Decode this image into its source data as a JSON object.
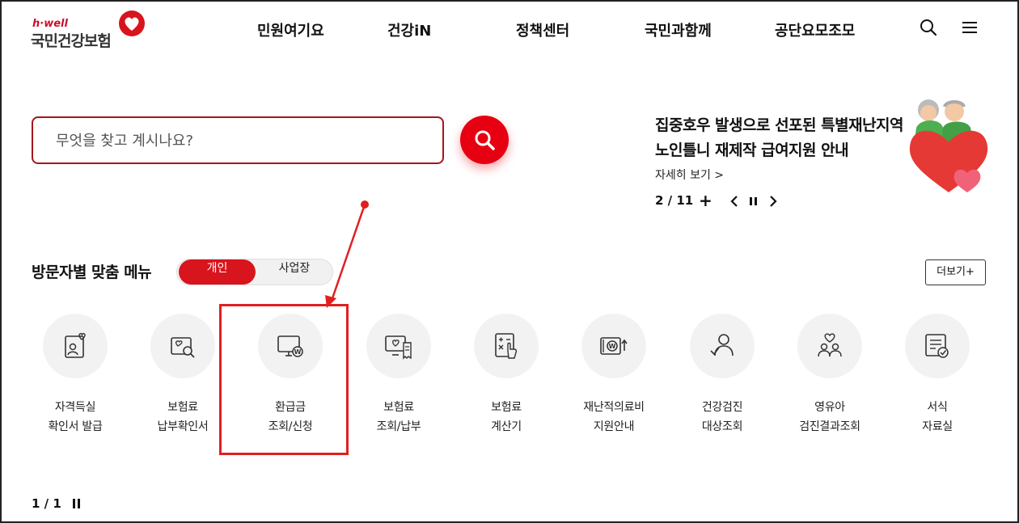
{
  "header": {
    "logo_tagline": "h·well",
    "logo_name": "국민건강보험",
    "nav": [
      "민원여기요",
      "건강iN",
      "정책센터",
      "국민과함께",
      "공단요모조모"
    ],
    "icons": [
      "search-icon",
      "hamburger-menu-icon"
    ]
  },
  "search": {
    "placeholder": "무엇을 찾고 계시나요?",
    "value": ""
  },
  "banner": {
    "title_line1": "집중호우 발생으로 선포된 특별재난지역",
    "title_line2": "노인틀니 재제작 급여지원 안내",
    "link": "자세히 보기 >",
    "page": "2 / 11",
    "plus": "+"
  },
  "section": {
    "title": "방문자별 맞춤 메뉴",
    "toggle": [
      "개인",
      "사업장"
    ],
    "active_toggle": "개인",
    "more": "더보기+"
  },
  "menu": [
    {
      "line1": "자격득실",
      "line2": "확인서 발급",
      "icon": "id-card-heart-icon"
    },
    {
      "line1": "보험료",
      "line2": "납부확인서",
      "icon": "document-search-icon"
    },
    {
      "line1": "환급금",
      "line2": "조회/신청",
      "icon": "monitor-won-icon"
    },
    {
      "line1": "보험료",
      "line2": "조회/납부",
      "icon": "monitor-receipt-icon"
    },
    {
      "line1": "보험료",
      "line2": "계산기",
      "icon": "calculator-icon"
    },
    {
      "line1": "재난적의료비",
      "line2": "지원안내",
      "icon": "won-up-icon"
    },
    {
      "line1": "건강검진",
      "line2": "대상조회",
      "icon": "people-check-icon"
    },
    {
      "line1": "영유아",
      "line2": "검진결과조회",
      "icon": "family-heart-icon"
    },
    {
      "line1": "서식",
      "line2": "자료실",
      "icon": "form-check-icon"
    }
  ],
  "pager": {
    "page": "1 / 1"
  },
  "colors": {
    "brand_red": "#e60012",
    "dark_red": "#a3161e",
    "annotation": "#e02020"
  }
}
